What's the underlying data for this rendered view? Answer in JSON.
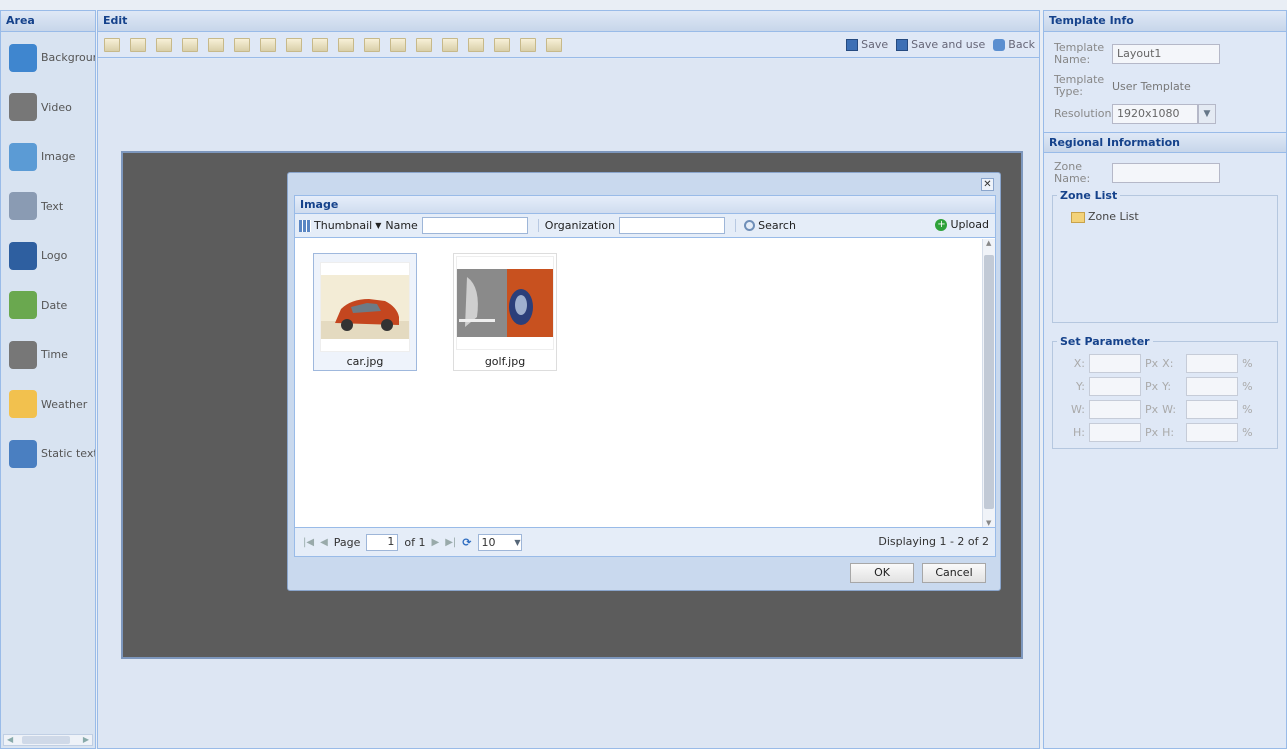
{
  "area": {
    "title": "Area",
    "items": [
      {
        "label": "Backgrour",
        "icon": "background-icon",
        "color": "#3f86cf"
      },
      {
        "label": "Video",
        "icon": "video-icon",
        "color": "#777777"
      },
      {
        "label": "Image",
        "icon": "image-icon",
        "color": "#5b9bd5"
      },
      {
        "label": "Text",
        "icon": "text-icon",
        "color": "#8a9bb3"
      },
      {
        "label": "Logo",
        "icon": "logo-icon",
        "color": "#2e5fa0"
      },
      {
        "label": "Date",
        "icon": "date-icon",
        "color": "#6aa84f"
      },
      {
        "label": "Time",
        "icon": "time-icon",
        "color": "#777777"
      },
      {
        "label": "Weather",
        "icon": "weather-icon",
        "color": "#f2c14e"
      },
      {
        "label": "Static text",
        "icon": "static-text-icon",
        "color": "#4a7fc1"
      }
    ]
  },
  "edit": {
    "title": "Edit",
    "toolbar_count": 18,
    "save_label": "Save",
    "save_use_label": "Save and use",
    "back_label": "Back"
  },
  "template_info": {
    "title": "Template Info",
    "name_label": "Template Name:",
    "name_value": "Layout1",
    "type_label": "Template Type:",
    "type_value": "User Template",
    "resolution_label": "Resolution:",
    "resolution_value": "1920x1080"
  },
  "regional": {
    "title": "Regional Information",
    "zone_name_label": "Zone Name:",
    "zone_list_legend": "Zone List",
    "zone_list_item": "Zone List"
  },
  "params": {
    "legend": "Set Parameter",
    "rows": [
      {
        "a": "X:",
        "px": "Px",
        "b": "X:",
        "pct": "%"
      },
      {
        "a": "Y:",
        "px": "Px",
        "b": "Y:",
        "pct": "%"
      },
      {
        "a": "W:",
        "px": "Px",
        "b": "W:",
        "pct": "%"
      },
      {
        "a": "H:",
        "px": "Px",
        "b": "H:",
        "pct": "%"
      }
    ]
  },
  "dialog": {
    "title": "Image",
    "view_label": "Thumbnail",
    "name_label": "Name",
    "org_label": "Organization",
    "search_label": "Search",
    "upload_label": "Upload",
    "images": [
      {
        "caption": "car.jpg",
        "selected": true
      },
      {
        "caption": "golf.jpg",
        "selected": false
      }
    ],
    "pager": {
      "page_label": "Page",
      "page_value": "1",
      "of_label": "of 1",
      "page_size": "10",
      "display_text": "Displaying 1 - 2 of 2"
    },
    "ok_label": "OK",
    "cancel_label": "Cancel"
  }
}
